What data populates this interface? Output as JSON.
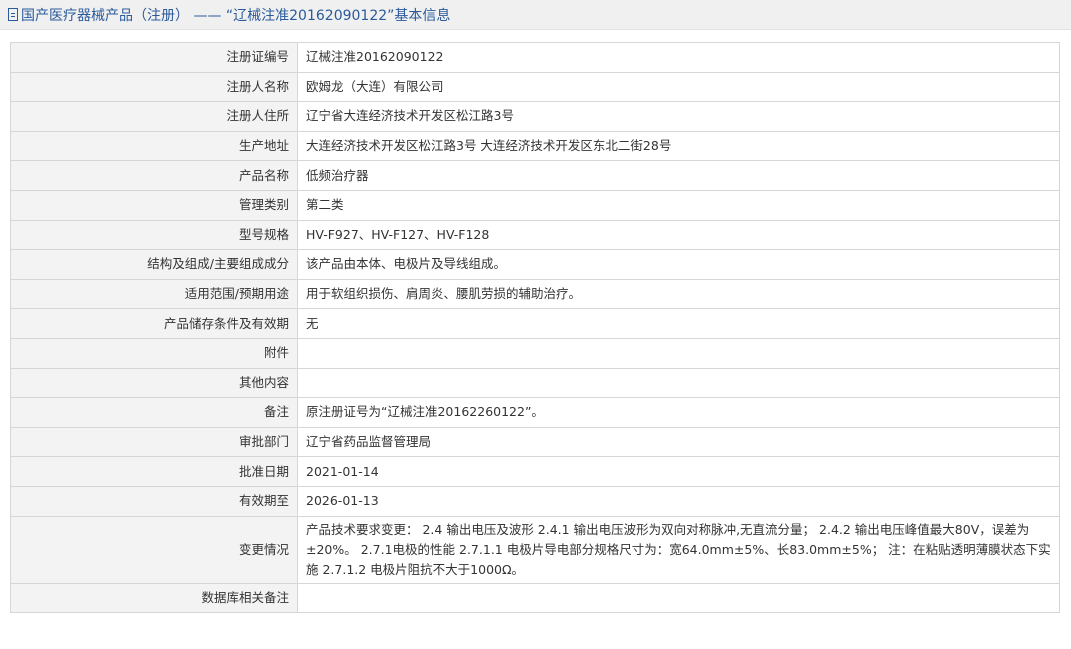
{
  "header": {
    "title": "国产医疗器械产品（注册） —— “辽械注准20162090122”基本信息",
    "icon": "document-icon"
  },
  "rows": [
    {
      "label": "注册证编号",
      "value": "辽械注准20162090122"
    },
    {
      "label": "注册人名称",
      "value": "欧姆龙（大连）有限公司"
    },
    {
      "label": "注册人住所",
      "value": "辽宁省大连经济技术开发区松江路3号"
    },
    {
      "label": "生产地址",
      "value": "大连经济技术开发区松江路3号 大连经济技术开发区东北二街28号"
    },
    {
      "label": "产品名称",
      "value": "低频治疗器"
    },
    {
      "label": "管理类别",
      "value": "第二类"
    },
    {
      "label": "型号规格",
      "value": "HV-F927、HV-F127、HV-F128"
    },
    {
      "label": "结构及组成/主要组成成分",
      "value": "该产品由本体、电极片及导线组成。"
    },
    {
      "label": "适用范围/预期用途",
      "value": "用于软组织损伤、肩周炎、腰肌劳损的辅助治疗。"
    },
    {
      "label": "产品储存条件及有效期",
      "value": "无"
    },
    {
      "label": "附件",
      "value": ""
    },
    {
      "label": "其他内容",
      "value": ""
    },
    {
      "label": "备注",
      "value": "原注册证号为“辽械注准20162260122”。"
    },
    {
      "label": "审批部门",
      "value": "辽宁省药品监督管理局"
    },
    {
      "label": "批准日期",
      "value": "2021-01-14"
    },
    {
      "label": "有效期至",
      "value": "2026-01-13"
    },
    {
      "label": "变更情况",
      "value": "产品技术要求变更： 2.4 输出电压及波形 2.4.1 输出电压波形为双向对称脉冲,无直流分量； 2.4.2 输出电压峰值最大80V，误差为±20%。 2.7.1电极的性能 2.7.1.1 电极片导电部分规格尺寸为：宽64.0mm±5%、长83.0mm±5%； 注：在粘贴透明薄膜状态下实施 2.7.1.2 电极片阻抗不大于1000Ω。"
    },
    {
      "label": "数据库相关备注",
      "value": ""
    }
  ]
}
